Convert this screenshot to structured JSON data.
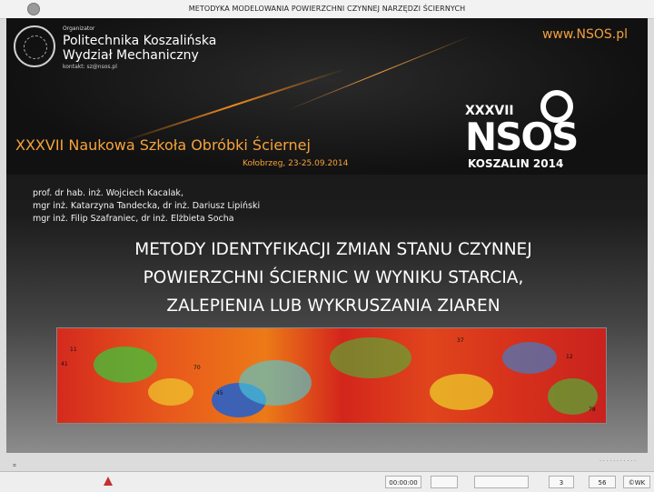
{
  "window": {
    "title": "METODYKA MODELOWANIA POWIERZCHNI CZYNNEJ NARZĘDZI ŚCIERNYCH"
  },
  "banner": {
    "organizer_label": "Organizator",
    "organizer_name": "Politechnika Koszalińska",
    "faculty": "Wydział Mechaniczny",
    "contact": "kontakt: sz@nsos.pl",
    "website": "www.NSOS.pl",
    "school_title": "XXXVII Naukowa Szkoła Obróbki Ściernej",
    "dates": "Kołobrzeg, 23-25.09.2014",
    "edition": "XXXVII",
    "logo_text": "NSOS",
    "city_year": "KOSZALIN 2014"
  },
  "slide": {
    "authors": [
      "prof. dr hab. inż. Wojciech Kacalak,",
      "mgr inż. Katarzyna Tandecka, dr inż. Dariusz Lipiński",
      "mgr inż. Filip Szafraniec, dr inż. Elżbieta Socha"
    ],
    "title_lines": [
      "METODY IDENTYFIKACJI ZMIAN STANU CZYNNEJ",
      "POWIERZCHNI ŚCIERNIC W WYNIKU STARCIA,",
      "ZALEPIENIA LUB WYKRUSZANIA ZIAREN"
    ],
    "map_labels": [
      "11",
      "41",
      "70",
      "45",
      "37",
      "12",
      "78"
    ]
  },
  "statusbar": {
    "timer": "00:00:00",
    "page_current": "3",
    "page_total": "56",
    "copyright": "©WK"
  },
  "colors": {
    "accent": "#f6a33a",
    "map_red": "#d42a1e",
    "map_blue": "#1f5fd0",
    "map_green": "#3ec63a"
  }
}
